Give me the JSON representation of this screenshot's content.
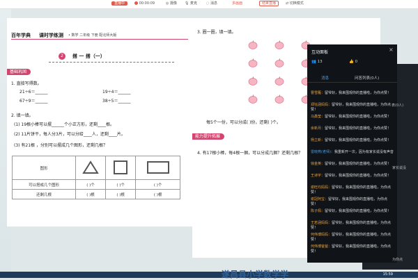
{
  "toolbar": {
    "live_badge": "直播中",
    "timer": "00:00:09",
    "camera": "摄像",
    "mic": "麦克",
    "sound": "消息",
    "multi_view": "多画面",
    "end_live": "结束直播",
    "switch_mode": "切换模式"
  },
  "book": {
    "brand": "百年学典",
    "series": "课时学练测",
    "meta": "• 数学   二年级   下册   配北师大版",
    "lesson_no": "2",
    "lesson_title": "搭  一  搭（一）",
    "section_basic": "基础巩固",
    "q1": "1. 直接写得数。",
    "q1_items": [
      "21÷6＝______",
      "19÷4＝______",
      "67÷9＝______",
      "38÷5＝______"
    ],
    "q2": "2. 填一填。",
    "q2_1": "(1) 19根小棒可以摆______个小正方形，还剩____根。",
    "q2_2": "(2) 11片饼干，每人分3片，可以分给____人，还剩____片。",
    "q3": "(3) 有21根  ，分别可以摆成几个图形，还剩几根？",
    "table_rows": [
      "图形",
      "可以搭成几个图形",
      "还剩几根"
    ],
    "table_cell_count": "(     )个",
    "table_cell_left": "(     )根",
    "q_right": "3. 圈一圈，填一填。",
    "right_fill": "每5个一份，可以分成(     )份，还剩(     )个。",
    "section_extend": "能力提升拓展",
    "q4": "4. 有17根小棒，每4根一捆，可以分成几捆？还剩几根？",
    "page_left": "",
    "page_right": ""
  },
  "panel": {
    "title": "互动面板",
    "close": "×",
    "user_count": "13",
    "likes": "0",
    "tab_chat": "消息",
    "tab_questions": "问答列表(0人)",
    "messages": [
      {
        "name": "曹雪雁：",
        "text": "留爷好，我来围观你的直播啦，为你点赞！"
      },
      {
        "name": "郑钰涵妈妈：",
        "text": "留爷好，我来围观你的直播啦，为你点赞！"
      },
      {
        "name": "马鑫莹：",
        "text": "留爷好，我来围观你的直播啦，为你点赞！"
      },
      {
        "name": "余新月：",
        "text": "留爷好，我来围观你的直播啦，为你点赞！"
      },
      {
        "name": "杨立新：",
        "text": "留爷好，我来围观你的直播啦，为你点赞！"
      },
      {
        "name": "雷晓燕(老师)：",
        "text": "我重新开一次，因为有家长说没有声音"
      },
      {
        "name": "徐金英：",
        "text": "留爷好，我来围观你的直播啦，为你点赞！"
      },
      {
        "name": "王诗宇：",
        "text": "留爷好，我来围观你的直播啦，为你点赞！"
      },
      {
        "name": "谢旺均妈妈：",
        "text": "留爷好，我来围观你的直播啦，为你点赞！"
      },
      {
        "name": "谢冠阿宝：",
        "text": "留爷好，我来围观你的直播啦，为你点赞！"
      },
      {
        "name": "陈子佩：",
        "text": "留爷好，我来围观你的直播啦，为你点赞！"
      },
      {
        "name": "王若涵妈妈：",
        "text": "留爷好，我来围观你的直播啦，为你点赞！"
      },
      {
        "name": "何伟博妈妈：",
        "text": "留爷好，我来围观你的直播啦，为你点赞！"
      },
      {
        "name": "何伟博爸爸：",
        "text": "留爷好，我来围观你的直播啦，为你点赞！"
      }
    ],
    "side_fragments": [
      "表(0人)",
      "家长说没",
      "为你点"
    ]
  },
  "watermark": "遂昌县小学数学学",
  "tray_clock": "15:59"
}
